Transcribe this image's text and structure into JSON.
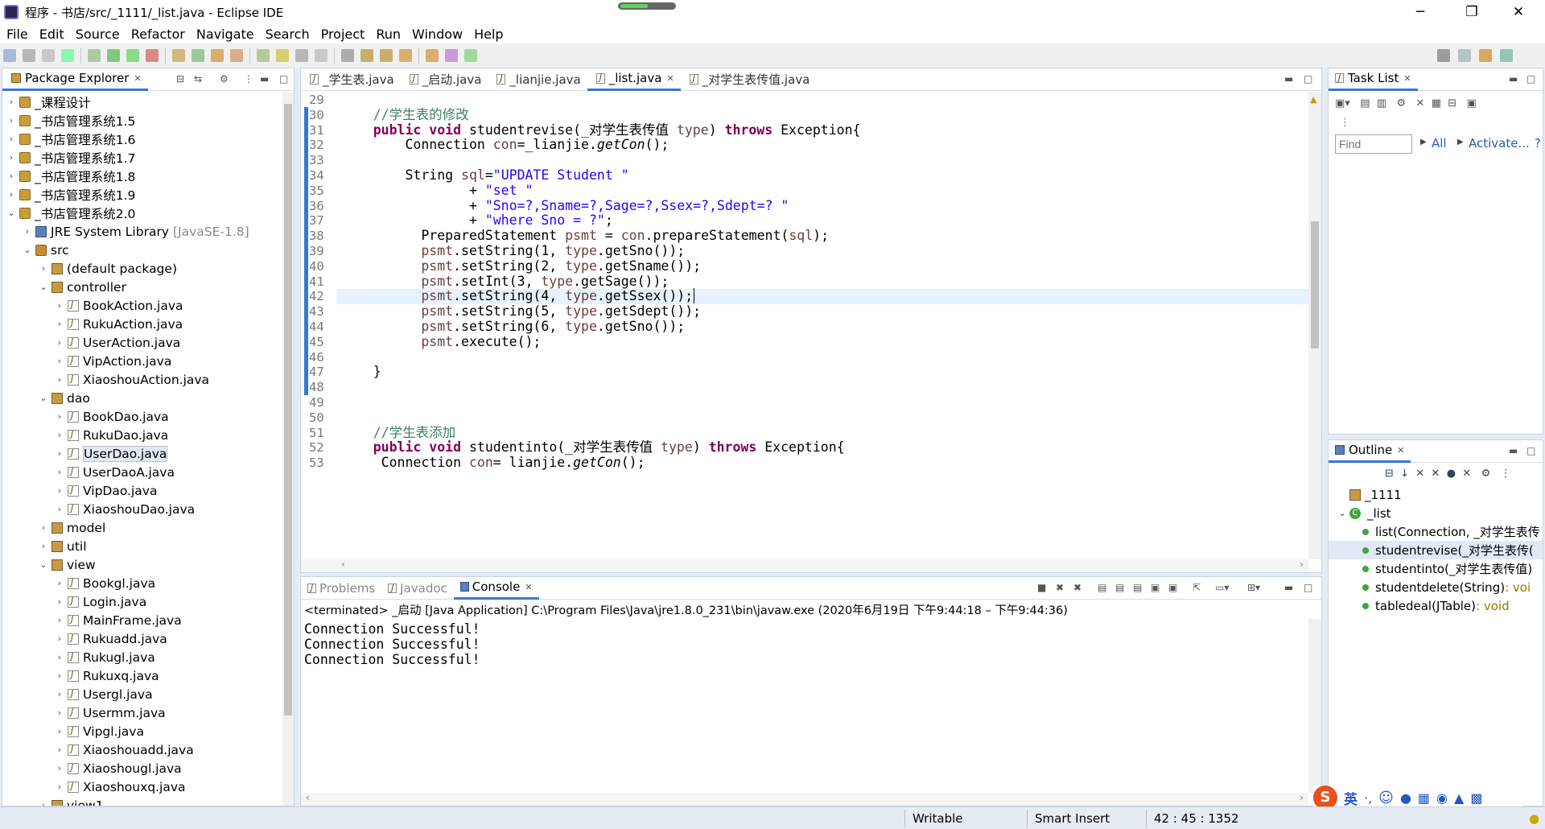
{
  "window": {
    "title": "程序 - 书店/src/_1111/_list.java - Eclipse IDE",
    "minimize": "─",
    "restore": "❐",
    "close": "✕"
  },
  "menu": [
    "File",
    "Edit",
    "Source",
    "Refactor",
    "Navigate",
    "Search",
    "Project",
    "Run",
    "Window",
    "Help"
  ],
  "explorer": {
    "title": "Package Explorer",
    "items": [
      {
        "label": "_课程设计",
        "arrow": "›",
        "icon": "prj",
        "indent": 0
      },
      {
        "label": "_书店管理系统1.5",
        "arrow": "›",
        "icon": "prj",
        "indent": 0
      },
      {
        "label": "_书店管理系统1.6",
        "arrow": "›",
        "icon": "prj",
        "indent": 0
      },
      {
        "label": "_书店管理系统1.7",
        "arrow": "›",
        "icon": "prj",
        "indent": 0
      },
      {
        "label": "_书店管理系统1.8",
        "arrow": "›",
        "icon": "prj",
        "indent": 0
      },
      {
        "label": "_书店管理系统1.9",
        "arrow": "›",
        "icon": "prj",
        "indent": 0
      },
      {
        "label": "_书店管理系统2.0",
        "arrow": "⌄",
        "icon": "prj",
        "indent": 0
      },
      {
        "label": "JRE System Library",
        "suffix": "[JavaSE-1.8]",
        "arrow": "›",
        "icon": "lib",
        "indent": 1
      },
      {
        "label": "src",
        "arrow": "⌄",
        "icon": "src",
        "indent": 1
      },
      {
        "label": "(default package)",
        "arrow": "›",
        "icon": "pkg",
        "indent": 2
      },
      {
        "label": "controller",
        "arrow": "⌄",
        "icon": "pkg",
        "indent": 2
      },
      {
        "label": "BookAction.java",
        "arrow": "›",
        "icon": "java",
        "indent": 3
      },
      {
        "label": "RukuAction.java",
        "arrow": "›",
        "icon": "java",
        "indent": 3
      },
      {
        "label": "UserAction.java",
        "arrow": "›",
        "icon": "java",
        "indent": 3
      },
      {
        "label": "VipAction.java",
        "arrow": "›",
        "icon": "java",
        "indent": 3
      },
      {
        "label": "XiaoshouAction.java",
        "arrow": "›",
        "icon": "java",
        "indent": 3
      },
      {
        "label": "dao",
        "arrow": "⌄",
        "icon": "pkg",
        "indent": 2
      },
      {
        "label": "BookDao.java",
        "arrow": "›",
        "icon": "java",
        "indent": 3
      },
      {
        "label": "RukuDao.java",
        "arrow": "›",
        "icon": "java",
        "indent": 3
      },
      {
        "label": "UserDao.java",
        "arrow": "›",
        "icon": "java",
        "indent": 3,
        "selected": true
      },
      {
        "label": "UserDaoA.java",
        "arrow": "›",
        "icon": "java",
        "indent": 3
      },
      {
        "label": "VipDao.java",
        "arrow": "›",
        "icon": "java",
        "indent": 3
      },
      {
        "label": "XiaoshouDao.java",
        "arrow": "›",
        "icon": "java",
        "indent": 3
      },
      {
        "label": "model",
        "arrow": "›",
        "icon": "pkg",
        "indent": 2
      },
      {
        "label": "util",
        "arrow": "›",
        "icon": "pkg",
        "indent": 2
      },
      {
        "label": "view",
        "arrow": "⌄",
        "icon": "pkg",
        "indent": 2
      },
      {
        "label": "Bookgl.java",
        "arrow": "›",
        "icon": "java",
        "indent": 3
      },
      {
        "label": "Login.java",
        "arrow": "›",
        "icon": "java",
        "indent": 3
      },
      {
        "label": "MainFrame.java",
        "arrow": "›",
        "icon": "java",
        "indent": 3
      },
      {
        "label": "Rukuadd.java",
        "arrow": "›",
        "icon": "java",
        "indent": 3
      },
      {
        "label": "Rukugl.java",
        "arrow": "›",
        "icon": "java",
        "indent": 3
      },
      {
        "label": "Rukuxq.java",
        "arrow": "›",
        "icon": "java",
        "indent": 3
      },
      {
        "label": "Usergl.java",
        "arrow": "›",
        "icon": "java",
        "indent": 3
      },
      {
        "label": "Usermm.java",
        "arrow": "›",
        "icon": "java",
        "indent": 3
      },
      {
        "label": "Vipgl.java",
        "arrow": "›",
        "icon": "java",
        "indent": 3
      },
      {
        "label": "Xiaoshouadd.java",
        "arrow": "›",
        "icon": "java",
        "indent": 3
      },
      {
        "label": "Xiaoshougl.java",
        "arrow": "›",
        "icon": "java",
        "indent": 3
      },
      {
        "label": "Xiaoshouxq.java",
        "arrow": "›",
        "icon": "java",
        "indent": 3
      },
      {
        "label": "view1",
        "arrow": "›",
        "icon": "pkg",
        "indent": 2
      }
    ]
  },
  "editor": {
    "tabs": [
      {
        "label": "_学生表.java",
        "active": false
      },
      {
        "label": "_启动.java",
        "active": false
      },
      {
        "label": "_lianjie.java",
        "active": false
      },
      {
        "label": "_list.java",
        "active": true
      },
      {
        "label": "_对学生表传值.java",
        "active": false
      }
    ],
    "lines": [
      {
        "n": "29",
        "t": []
      },
      {
        "n": "30",
        "t": [
          [
            "cm",
            "    //学生表的修改"
          ]
        ]
      },
      {
        "n": "31",
        "t": [
          [
            "",
            "    "
          ],
          [
            "kw",
            "public"
          ],
          [
            "",
            " "
          ],
          [
            "kw",
            "void"
          ],
          [
            "",
            " studentrevise(_对学生表传值 "
          ],
          [
            "var",
            "type"
          ],
          [
            "",
            ") "
          ],
          [
            "kw",
            "throws"
          ],
          [
            "",
            " Exception{"
          ]
        ]
      },
      {
        "n": "32",
        "t": [
          [
            "",
            "        Connection "
          ],
          [
            "var",
            "con"
          ],
          [
            "",
            "=_lianjie."
          ],
          [
            "it",
            "getCon"
          ],
          [
            "",
            "();"
          ]
        ]
      },
      {
        "n": "33",
        "t": []
      },
      {
        "n": "34",
        "t": [
          [
            "",
            "        String "
          ],
          [
            "var",
            "sql"
          ],
          [
            "",
            "="
          ],
          [
            "str",
            "\"UPDATE Student \""
          ]
        ]
      },
      {
        "n": "35",
        "t": [
          [
            "",
            "                + "
          ],
          [
            "str",
            "\"set \""
          ]
        ]
      },
      {
        "n": "36",
        "t": [
          [
            "",
            "                + "
          ],
          [
            "str",
            "\"Sno=?,Sname=?,Sage=?,Ssex=?,Sdept=? \""
          ]
        ]
      },
      {
        "n": "37",
        "t": [
          [
            "",
            "                + "
          ],
          [
            "str",
            "\"where Sno = ?\""
          ],
          [
            "",
            ";"
          ]
        ]
      },
      {
        "n": "38",
        "t": [
          [
            "",
            "          PreparedStatement "
          ],
          [
            "var",
            "psmt"
          ],
          [
            "",
            " = "
          ],
          [
            "var",
            "con"
          ],
          [
            "",
            ".prepareStatement("
          ],
          [
            "var",
            "sql"
          ],
          [
            "",
            ");"
          ]
        ]
      },
      {
        "n": "39",
        "t": [
          [
            "",
            "          "
          ],
          [
            "var",
            "psmt"
          ],
          [
            "",
            ".setString(1, "
          ],
          [
            "var",
            "type"
          ],
          [
            "",
            ".getSno());"
          ]
        ]
      },
      {
        "n": "40",
        "t": [
          [
            "",
            "          "
          ],
          [
            "var",
            "psmt"
          ],
          [
            "",
            ".setString(2, "
          ],
          [
            "var",
            "type"
          ],
          [
            "",
            ".getSname());"
          ]
        ]
      },
      {
        "n": "41",
        "t": [
          [
            "",
            "          "
          ],
          [
            "var",
            "psmt"
          ],
          [
            "",
            ".setInt(3, "
          ],
          [
            "var",
            "type"
          ],
          [
            "",
            ".getSage());"
          ]
        ]
      },
      {
        "n": "42",
        "t": [
          [
            "",
            "          "
          ],
          [
            "var",
            "psmt"
          ],
          [
            "",
            ".setString(4, "
          ],
          [
            "var",
            "type"
          ],
          [
            "",
            ".getSsex());"
          ]
        ],
        "cur": true
      },
      {
        "n": "43",
        "t": [
          [
            "",
            "          "
          ],
          [
            "var",
            "psmt"
          ],
          [
            "",
            ".setString(5, "
          ],
          [
            "var",
            "type"
          ],
          [
            "",
            ".getSdept());"
          ]
        ]
      },
      {
        "n": "44",
        "t": [
          [
            "",
            "          "
          ],
          [
            "var",
            "psmt"
          ],
          [
            "",
            ".setString(6, "
          ],
          [
            "var",
            "type"
          ],
          [
            "",
            ".getSno());"
          ]
        ]
      },
      {
        "n": "45",
        "t": [
          [
            "",
            "          "
          ],
          [
            "var",
            "psmt"
          ],
          [
            "",
            ".execute();"
          ]
        ]
      },
      {
        "n": "46",
        "t": []
      },
      {
        "n": "47",
        "t": [
          [
            "",
            "    }"
          ]
        ]
      },
      {
        "n": "48",
        "t": []
      },
      {
        "n": "49",
        "t": []
      },
      {
        "n": "50",
        "t": []
      },
      {
        "n": "51",
        "t": [
          [
            "cm",
            "    //学生表添加"
          ]
        ]
      },
      {
        "n": "52",
        "t": [
          [
            "",
            "    "
          ],
          [
            "kw",
            "public"
          ],
          [
            "",
            " "
          ],
          [
            "kw",
            "void"
          ],
          [
            "",
            " studentinto(_对学生表传值 "
          ],
          [
            "var",
            "type"
          ],
          [
            "",
            ") "
          ],
          [
            "kw",
            "throws"
          ],
          [
            "",
            " Exception{"
          ]
        ]
      },
      {
        "n": "53",
        "t": [
          [
            "",
            "     Connection "
          ],
          [
            "var",
            "con"
          ],
          [
            "",
            "= lianjie."
          ],
          [
            "it",
            "getCon"
          ],
          [
            "",
            "();"
          ]
        ]
      }
    ]
  },
  "console": {
    "tabs": [
      {
        "label": "Problems",
        "active": false
      },
      {
        "label": "Javadoc",
        "active": false
      },
      {
        "label": "Console",
        "active": true
      }
    ],
    "header": "<terminated> _启动 [Java Application] C:\\Program Files\\Java\\jre1.8.0_231\\bin\\javaw.exe  (2020年6月19日 下午9:44:18 – 下午9:44:36)",
    "lines": [
      "Connection Successful!",
      "Connection Successful!",
      "Connection Successful!"
    ]
  },
  "tasklist": {
    "title": "Task List",
    "find_placeholder": "Find",
    "all": "All",
    "activate": "Activate..."
  },
  "outline": {
    "title": "Outline",
    "pkg": "_1111",
    "cls": "_list",
    "members": [
      {
        "name": "list(Connection, _对学生表传",
        "ret": ""
      },
      {
        "name": "studentrevise(_对学生表传(",
        "ret": "",
        "selected": true
      },
      {
        "name": "studentinto(_对学生表传值)",
        "ret": ""
      },
      {
        "name": "studentdelete(String)",
        "ret": " : voi"
      },
      {
        "name": "tabledeal(JTable)",
        "ret": " : void"
      }
    ]
  },
  "status": {
    "writable": "Writable",
    "insert": "Smart Insert",
    "position": "42 : 45 : 1352"
  },
  "ime": {
    "lang": "英"
  },
  "colors": {
    "accent": "#3874d8",
    "keyword": "#7f0055",
    "string": "#2a00ff",
    "comment": "#3f7f5f"
  }
}
